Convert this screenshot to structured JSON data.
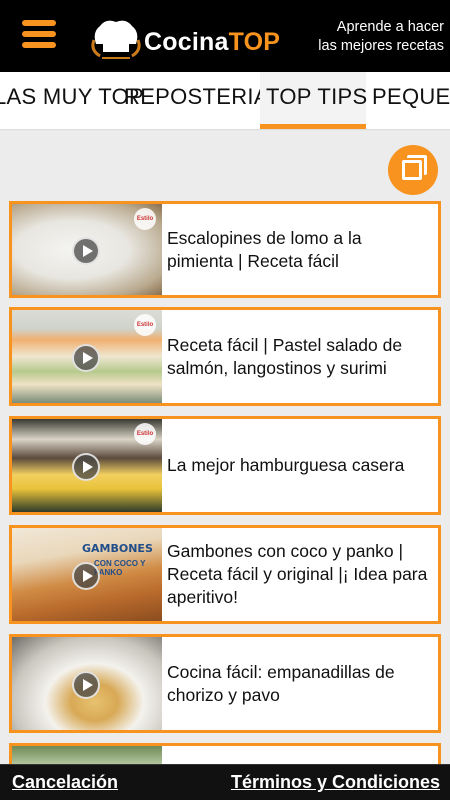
{
  "header": {
    "logo_text_a": "Cocina",
    "logo_text_b": "TOP",
    "tagline_line1": "Aprende a hacer",
    "tagline_line2": "las mejores recetas",
    "menu_icon": "hamburger-menu-icon",
    "brand_color": "#f7931e"
  },
  "tabs": [
    {
      "label": "LAS MUY TOP"
    },
    {
      "label": "REPOSTERIA"
    },
    {
      "label": "TOP TIPS",
      "active": true
    },
    {
      "label": "PEQUEÑOS"
    }
  ],
  "recipes": [
    {
      "title": "Escalopines de lomo a la pimienta | Receta fácil"
    },
    {
      "title": "Receta fácil | Pastel salado de salmón, langostinos y surimi"
    },
    {
      "title": "La mejor hamburguesa casera"
    },
    {
      "title": "Gambones con coco y panko | Receta fácil y original |¡ Idea para aperitivo!",
      "overlay_title": "GAMBONES",
      "overlay_sub": "CON COCO Y PANKO"
    },
    {
      "title": "Cocina fácil: empanadillas de chorizo y pavo"
    }
  ],
  "badge_text": "Estilo",
  "footer": {
    "cancel_label": "Cancelación",
    "terms_label": "Términos y Condiciones"
  }
}
